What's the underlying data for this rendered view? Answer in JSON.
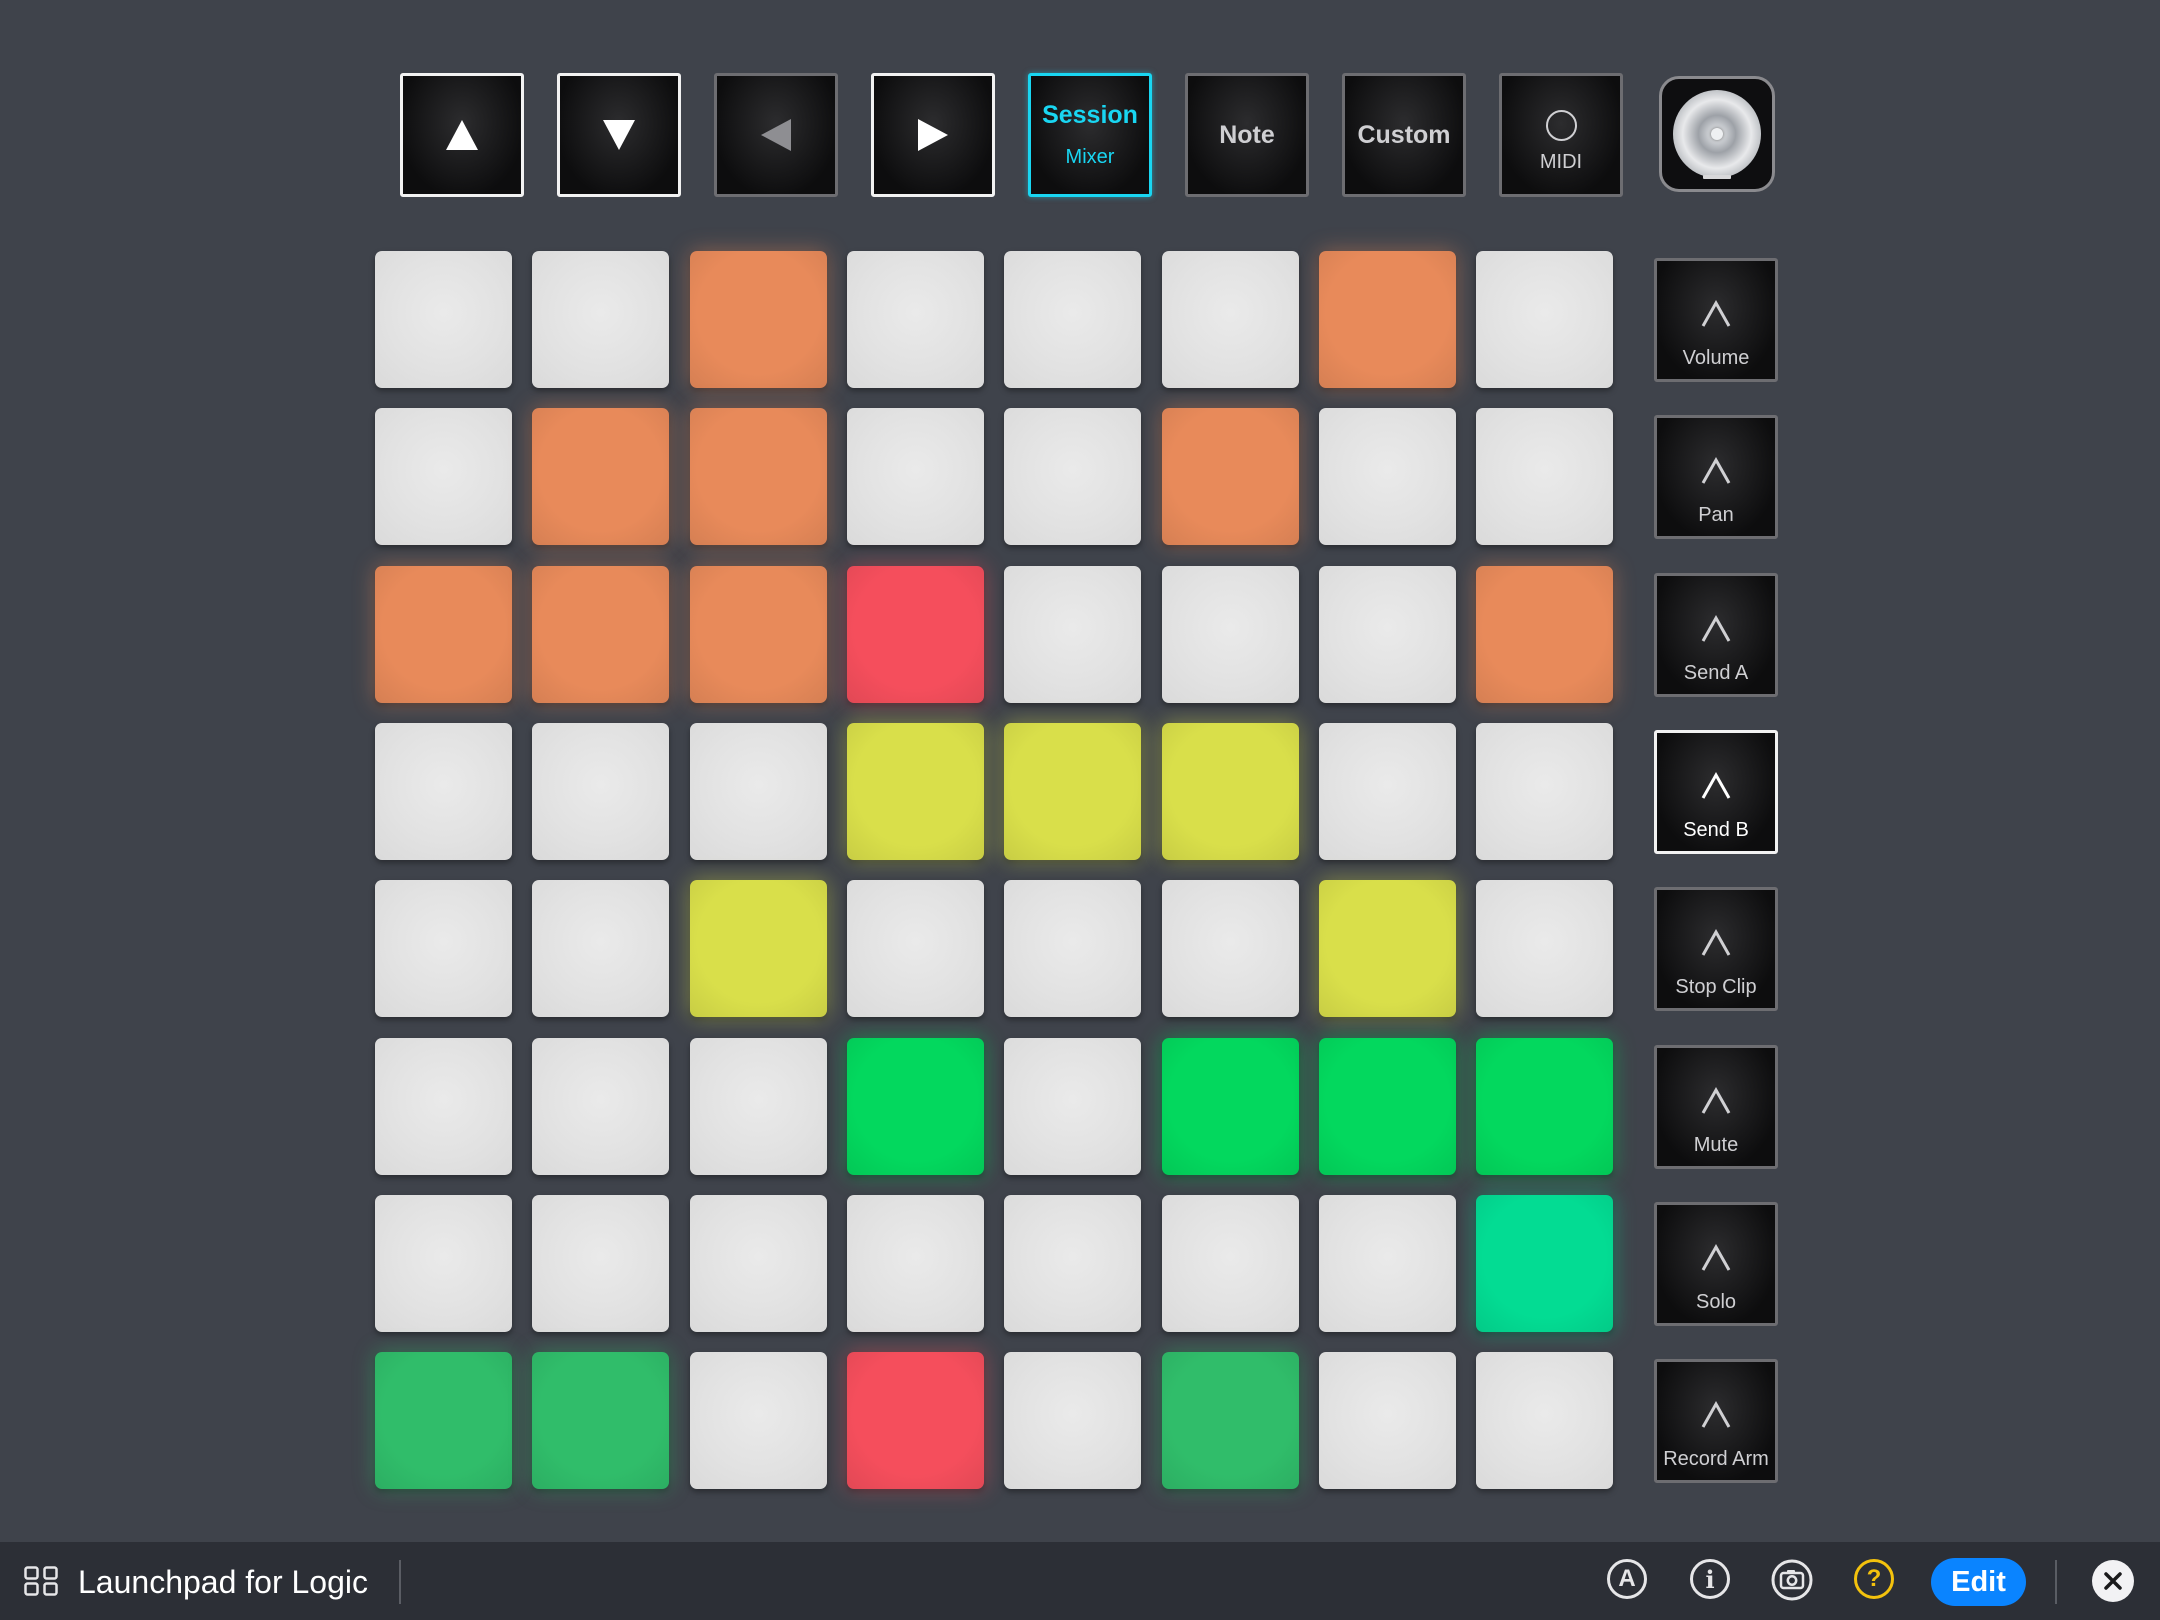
{
  "nav_buttons": {
    "up": "up-arrow",
    "down": "down-arrow",
    "left": "left-arrow",
    "right": "right-arrow"
  },
  "modes": {
    "session": {
      "label": "Session",
      "sub": "Mixer",
      "active": true
    },
    "note": {
      "label": "Note"
    },
    "custom": {
      "label": "Custom"
    },
    "midi": {
      "label": "MIDI"
    }
  },
  "colors": {
    "off": "#e4e4e4",
    "orange": "#e88a5a",
    "red": "#f54e5c",
    "yellow": "#d9df4a",
    "green": "#03d85e",
    "dark_green": "#30bd6a",
    "teal": "#03dc93",
    "accent_cyan": "#19d6f2",
    "edit_blue": "#0a84ff"
  },
  "pad_grid": [
    [
      "off",
      "off",
      "orange",
      "off",
      "off",
      "off",
      "orange",
      "off"
    ],
    [
      "off",
      "orange",
      "orange",
      "off",
      "off",
      "orange",
      "off",
      "off"
    ],
    [
      "orange",
      "orange",
      "orange",
      "red",
      "off",
      "off",
      "off",
      "orange"
    ],
    [
      "off",
      "off",
      "off",
      "yellow",
      "yellow",
      "yellow",
      "off",
      "off"
    ],
    [
      "off",
      "off",
      "yellow",
      "off",
      "off",
      "off",
      "yellow",
      "off"
    ],
    [
      "off",
      "off",
      "off",
      "green",
      "off",
      "green",
      "green",
      "green"
    ],
    [
      "off",
      "off",
      "off",
      "off",
      "off",
      "off",
      "off",
      "teal"
    ],
    [
      "dark_green",
      "dark_green",
      "off",
      "red",
      "off",
      "dark_green",
      "off",
      "off"
    ]
  ],
  "side_buttons": [
    {
      "label": "Volume",
      "selected": false
    },
    {
      "label": "Pan",
      "selected": false
    },
    {
      "label": "Send A",
      "selected": false
    },
    {
      "label": "Send B",
      "selected": true
    },
    {
      "label": "Stop Clip",
      "selected": false
    },
    {
      "label": "Mute",
      "selected": false
    },
    {
      "label": "Solo",
      "selected": false
    },
    {
      "label": "Record Arm",
      "selected": false
    }
  ],
  "bottom_bar": {
    "title": "Launchpad for Logic",
    "edit_label": "Edit",
    "a_icon_label": "A",
    "help_icon_label": "?",
    "info_icon_label": "i"
  }
}
